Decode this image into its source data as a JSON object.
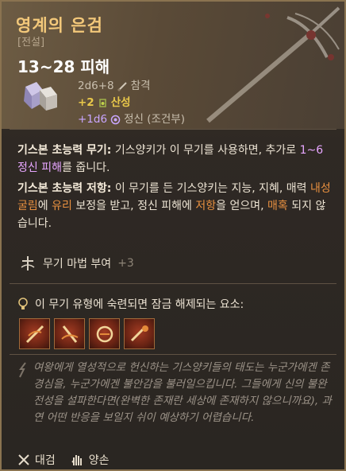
{
  "item": {
    "name": "영계의 은검",
    "type": "[전설]",
    "damage_total": "13~28 피해"
  },
  "damage_rows": [
    {
      "dice": "2d6+8",
      "kind": "참격",
      "dice_color": "muted",
      "kind_color": "muted",
      "icon": "slash-icon"
    },
    {
      "dice": "+2",
      "kind": "산성",
      "dice_color": "yellow",
      "kind_color": "yellow",
      "icon": "acid-icon"
    },
    {
      "dice": "+1d6",
      "kind": "정신 (조건부)",
      "dice_color": "violet",
      "kind_color": "muted",
      "icon": "psychic-icon"
    }
  ],
  "description": {
    "p1": {
      "label": "기스본 초능력 무기:",
      "t1": " 기스양키가 이 무기를 사용하면, 추가로 ",
      "hl": "1~6 정신 피해",
      "t2": "를 줍니다."
    },
    "p2": {
      "label": "기스본 초능력 저항:",
      "t1": " 이 무기를 든 기스양키는 지능, 지혜, 매력 ",
      "hl1": "내성 굴림",
      "t2": "에 ",
      "hl2": "유리",
      "t3": " 보정을 받고, 정신 피해에 ",
      "hl3": "저항",
      "t4": "을 얻으며, ",
      "hl4": "매혹",
      "t5": " 되지 않습니다."
    }
  },
  "enchant": {
    "label": "무기 마법 부여",
    "bonus": "+3"
  },
  "unlock": {
    "title": "이 무기 유형에 숙련되면 잠금 해제되는 요소:"
  },
  "skills": [
    {
      "name": "skill-icon-1"
    },
    {
      "name": "skill-icon-2"
    },
    {
      "name": "skill-icon-3"
    },
    {
      "name": "skill-icon-4"
    }
  ],
  "lore": "여왕에게 열성적으로 헌신하는 기스양키들의 태도는 누군가에겐 존경심을, 누군가에겐 불안감을 불러일으킵니다. 그들에게 신의 불완전성을 설파한다면(완벽한 존재란 세상에 존재하지 않으니까요), 과연 어떤 반응을 보일지 쉬이 예상하기 어렵습니다.",
  "footer": {
    "weapon_type": "대검",
    "handedness": "양손"
  },
  "colors": {
    "title": "#f3c87a",
    "highlight": "#e7a6ff",
    "acid": "#e9c84a"
  }
}
